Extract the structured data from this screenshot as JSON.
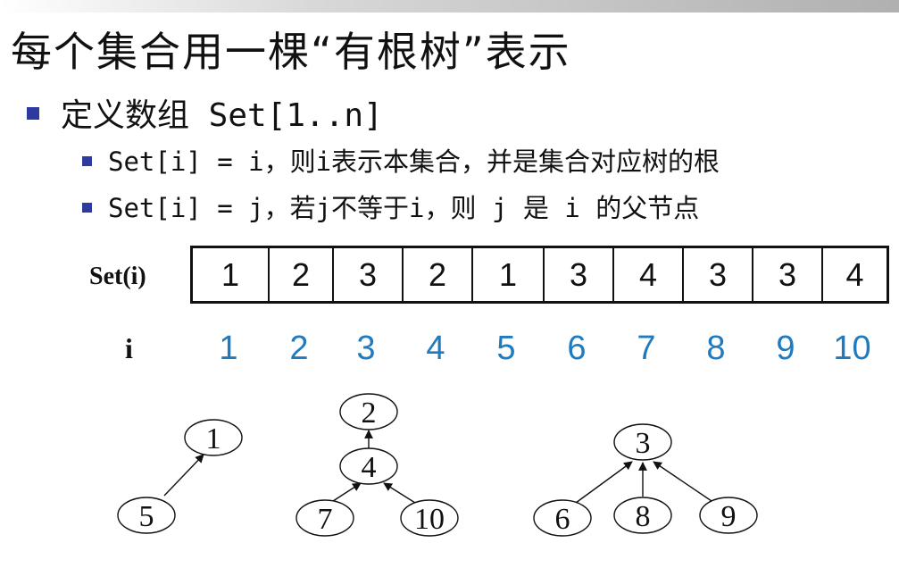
{
  "slide": {
    "title": "每个集合用一棵“有根树”表示",
    "bullet_main": "定义数组 Set[1..n]",
    "sub_bullets": [
      "Set[i] = i，则i表示本集合，并是集合对应树的根",
      "Set[i] = j，若j不等于i，则 j 是 i 的父节点"
    ]
  },
  "array": {
    "row_label": "Set(i)",
    "index_label": "i",
    "values": [
      "1",
      "2",
      "3",
      "2",
      "1",
      "3",
      "4",
      "3",
      "3",
      "4"
    ],
    "indices": [
      "1",
      "2",
      "3",
      "4",
      "5",
      "6",
      "7",
      "8",
      "9",
      "10"
    ],
    "index_color": "#1f7bbf"
  },
  "trees": {
    "nodes": [
      "1",
      "5",
      "2",
      "4",
      "7",
      "10",
      "3",
      "6",
      "8",
      "9"
    ],
    "edges": [
      [
        "5",
        "1"
      ],
      [
        "4",
        "2"
      ],
      [
        "7",
        "4"
      ],
      [
        "10",
        "4"
      ],
      [
        "6",
        "3"
      ],
      [
        "8",
        "3"
      ],
      [
        "9",
        "3"
      ]
    ]
  }
}
